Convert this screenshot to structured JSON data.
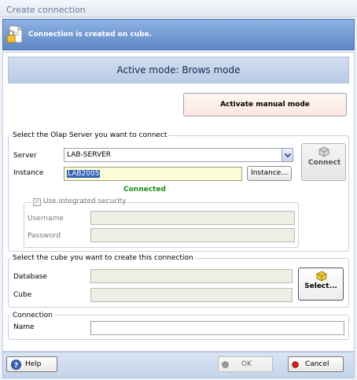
{
  "window": {
    "title": "Create connection"
  },
  "banner": {
    "message": "Connection is created on cube.",
    "icon": "document-lock-icon"
  },
  "mode": {
    "label": "Active mode: Brows mode",
    "manual_button": "Activate manual mode"
  },
  "server_group": {
    "title": "Select the Olap Server you want to connect",
    "server_label": "Server",
    "server_value": "LAB-SERVER",
    "instance_label": "Instance",
    "instance_value": "LAB2005",
    "instance_button": "Instance...",
    "connect_button": "Connect",
    "status": "Connected",
    "status_color": "#1b8c1b",
    "security": {
      "checkbox_label": "Use integrated security",
      "checked": true,
      "username_label": "Username",
      "username_value": "",
      "password_label": "Password",
      "password_value": ""
    }
  },
  "cube_group": {
    "title": "Select the cube you want to create this connection",
    "database_label": "Database",
    "database_value": "",
    "cube_label": "Cube",
    "cube_value": "",
    "select_button": "Select..."
  },
  "connection_group": {
    "title": "Connection",
    "name_label": "Name",
    "name_value": ""
  },
  "footer": {
    "help_button": "Help",
    "ok_button": "OK",
    "cancel_button": "Cancel"
  }
}
